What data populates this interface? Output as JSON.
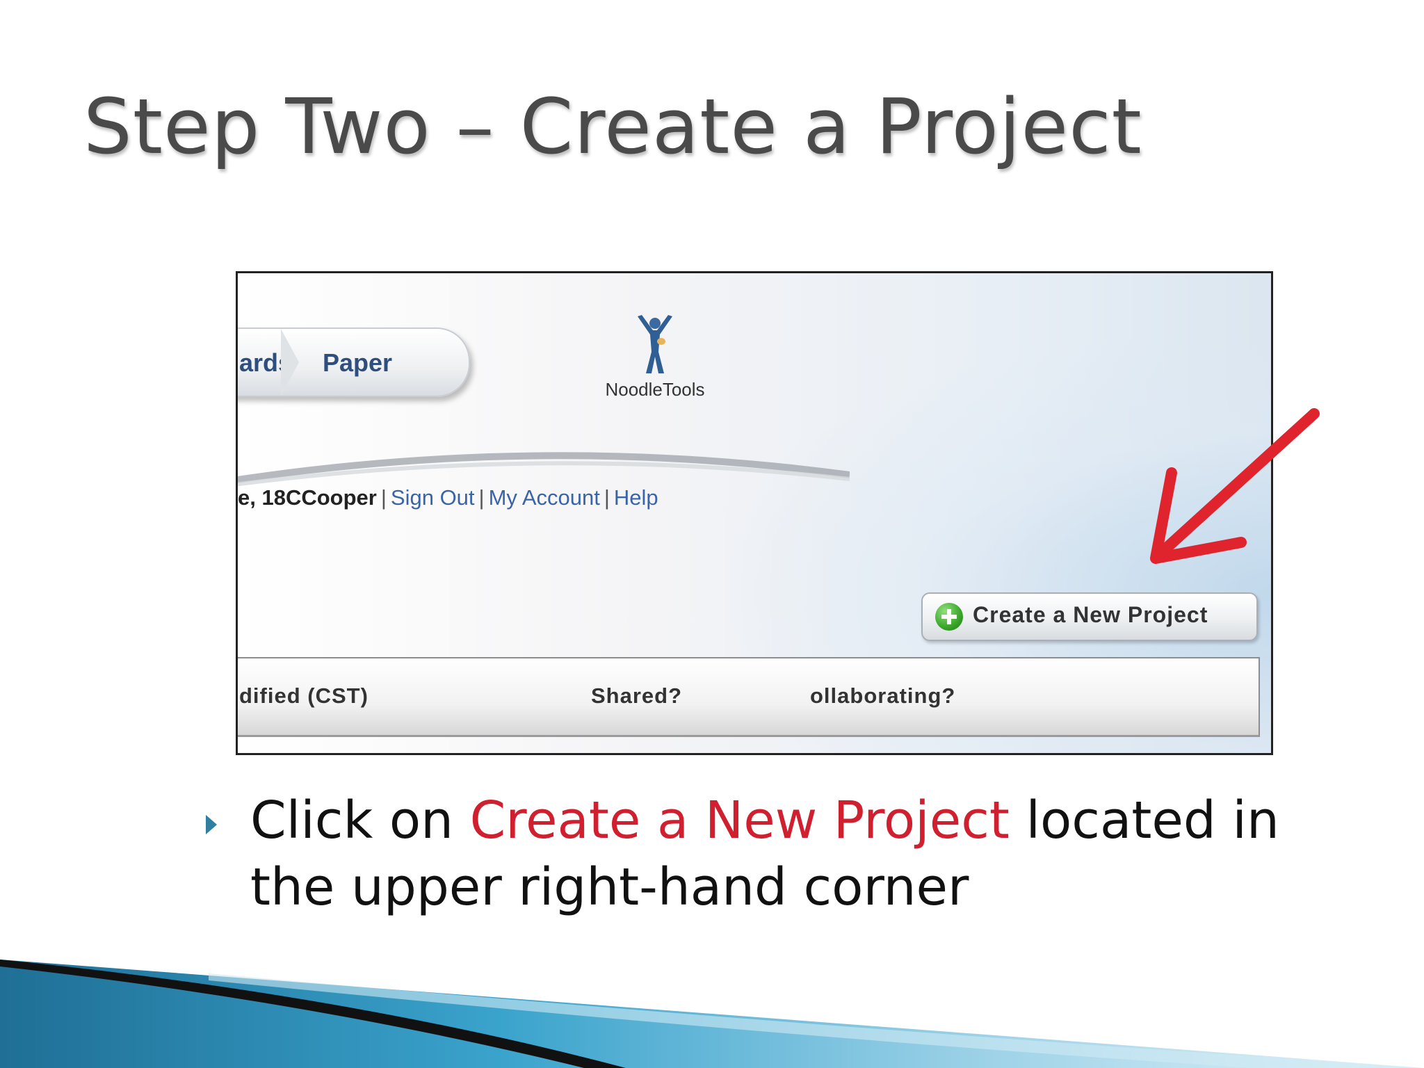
{
  "slide": {
    "title": "Step Two – Create a Project"
  },
  "screenshot": {
    "nav": {
      "item_cards": "ards",
      "item_paper": "Paper"
    },
    "logo_text": "NoodleTools",
    "userbar": {
      "user": "e, 18CCooper",
      "sign_out": "Sign Out",
      "my_account": "My Account",
      "help": "Help",
      "separator": "|"
    },
    "create_button_label": "Create a New Project",
    "table_headers": {
      "modified": "dified (CST)",
      "shared": "Shared?",
      "collaborating": "ollaborating?"
    }
  },
  "bullet": {
    "prefix": "Click on ",
    "highlight": "Create a New Project",
    "suffix_line1": " located in",
    "line2": "the upper right-hand corner"
  },
  "colors": {
    "highlight": "#d0202f",
    "arrow": "#e0242e",
    "title_text": "#4a4a4a",
    "accent_blue": "#2e7fa0"
  }
}
